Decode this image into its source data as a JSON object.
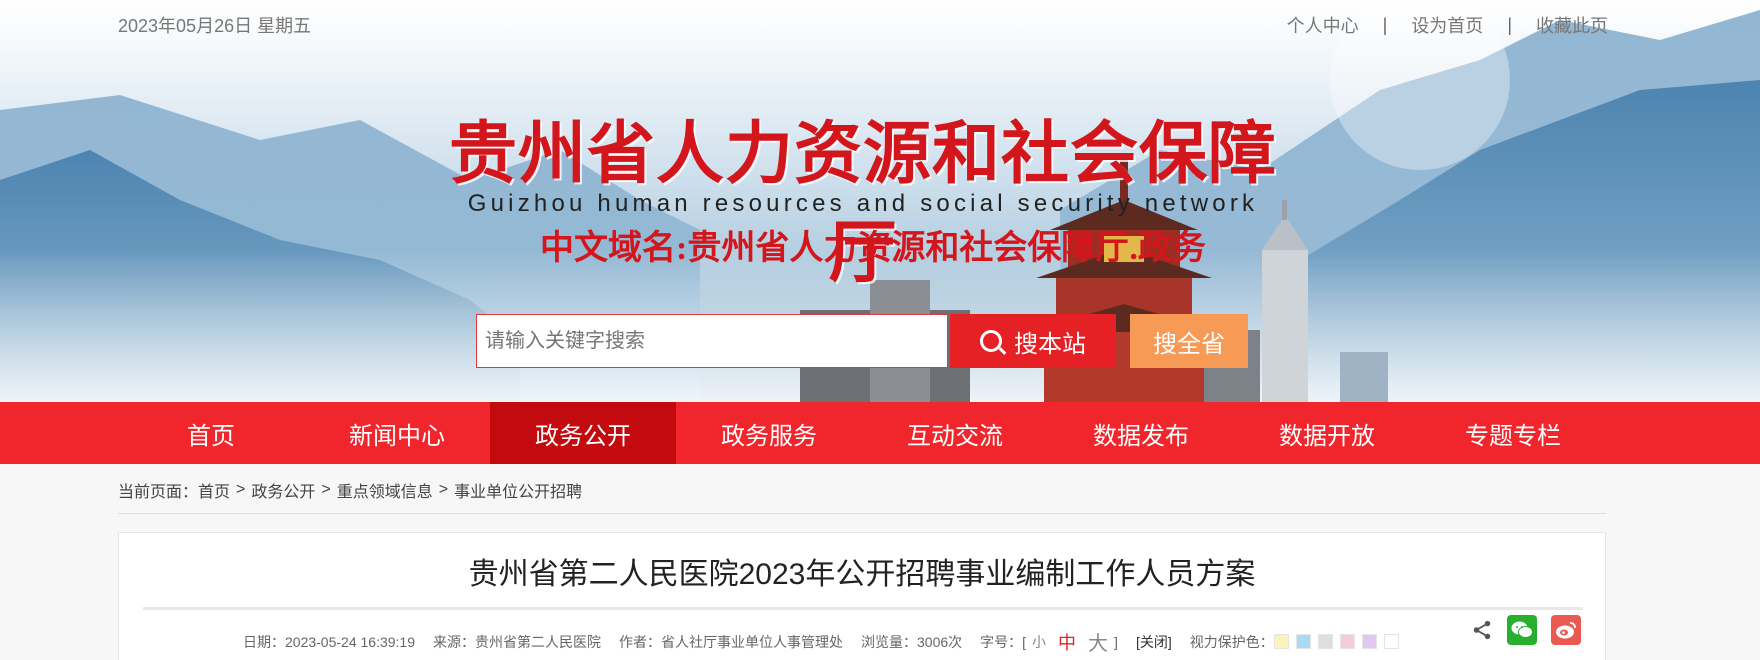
{
  "header": {
    "date": "2023年05月26日 星期五",
    "links": [
      "个人中心",
      "设为首页",
      "收藏此页"
    ],
    "separator": "|",
    "title_cn": "贵州省人力资源和社会保障厅",
    "title_en": "Guizhou human resources and social security network",
    "domain": "中文域名:贵州省人力资源和社会保障厅.政务"
  },
  "search": {
    "placeholder": "请输入关键字搜索",
    "btn_site": "搜本站",
    "btn_province": "搜全省"
  },
  "nav": [
    {
      "label": "首页",
      "active": false
    },
    {
      "label": "新闻中心",
      "active": false
    },
    {
      "label": "政务公开",
      "active": true
    },
    {
      "label": "政务服务",
      "active": false
    },
    {
      "label": "互动交流",
      "active": false
    },
    {
      "label": "数据发布",
      "active": false
    },
    {
      "label": "数据开放",
      "active": false
    },
    {
      "label": "专题专栏",
      "active": false
    }
  ],
  "breadcrumb": {
    "prefix": "当前页面：",
    "items": [
      "首页",
      "政务公开",
      "重点领域信息",
      "事业单位公开招聘"
    ],
    "sep": ">"
  },
  "article": {
    "title": "贵州省第二人民医院2023年公开招聘事业编制工作人员方案",
    "date": "日期：2023-05-24 16:39:19",
    "source": "来源：贵州省第二人民医院",
    "author": "作者：省人社厅事业单位人事管理处",
    "views": "浏览量：3006次",
    "font_label": "字号：",
    "font_open": "[",
    "font_small": "小",
    "font_medium": "中",
    "font_large": "大",
    "font_close": "]",
    "close": "[关闭]",
    "eye_label": "视力保护色：",
    "swatches": [
      "#faf4b8",
      "#a8dcf4",
      "#dedede",
      "#f6ccd8",
      "#e0c8f2",
      "#ffffff"
    ]
  },
  "share": {
    "share_icon": "share-icon",
    "wechat_icon": "wechat-icon",
    "weibo_icon": "weibo-icon"
  },
  "colors": {
    "brand_red": "#e62126",
    "nav_active": "#c20a0f",
    "orange_button": "#f79a55"
  }
}
